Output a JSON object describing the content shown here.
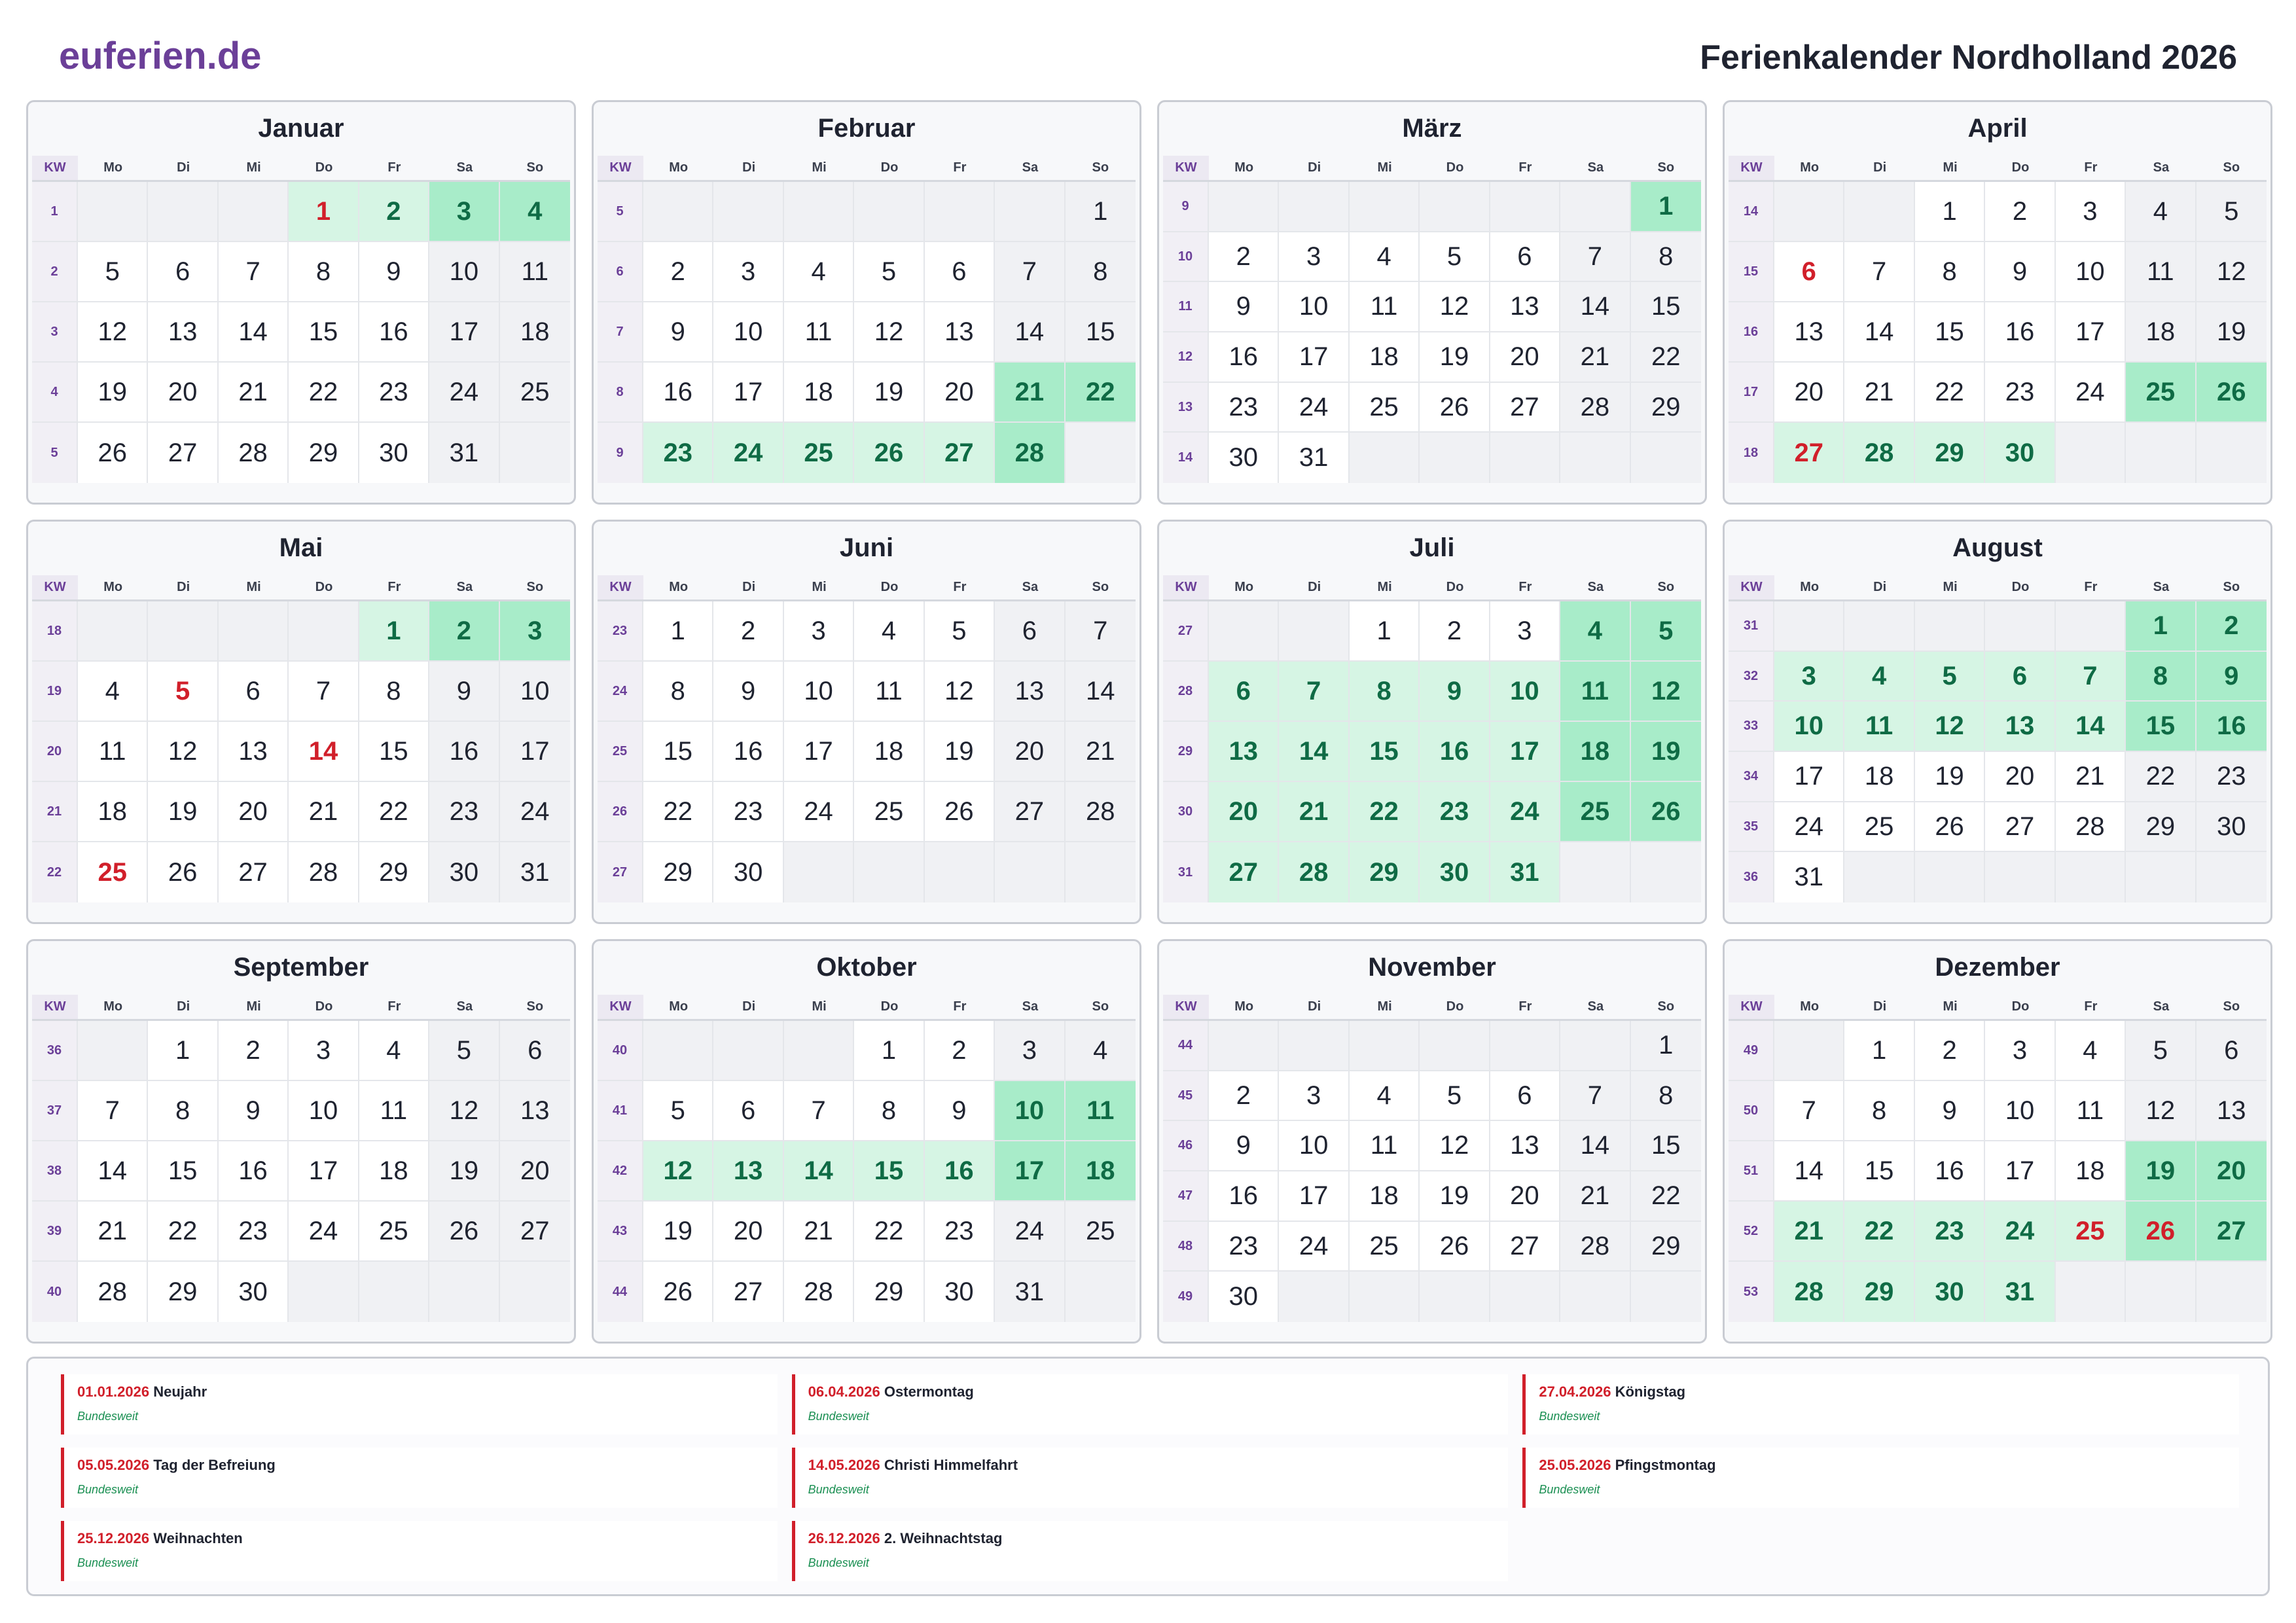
{
  "header": {
    "logo": "euferien.de",
    "title": "Ferienkalender Nordholland 2026"
  },
  "weekday_header": {
    "kw": "KW",
    "days": [
      "Mo",
      "Di",
      "Mi",
      "Do",
      "Fr",
      "Sa",
      "So"
    ]
  },
  "colors": {
    "brand": "#6b3f98",
    "holiday_red": "#d11f2a",
    "vacation_green": "#0f6b45",
    "vacation_bg": "#d6f5e4",
    "vacation_weekend_bg": "#a8ecc9"
  },
  "months": [
    {
      "name": "Januar",
      "startDow": 3,
      "days": 31,
      "kw": [
        "1",
        "2",
        "3",
        "4",
        "5"
      ],
      "vacation": [
        1,
        2,
        3,
        4
      ],
      "holidays": [
        1
      ]
    },
    {
      "name": "Februar",
      "startDow": 6,
      "days": 28,
      "kw": [
        "5",
        "6",
        "7",
        "8",
        "9"
      ],
      "vacation": [
        21,
        22,
        23,
        24,
        25,
        26,
        27,
        28
      ],
      "holidays": []
    },
    {
      "name": "März",
      "startDow": 6,
      "days": 31,
      "kw": [
        "9",
        "10",
        "11",
        "12",
        "13",
        "14"
      ],
      "vacation": [
        1
      ],
      "holidays": []
    },
    {
      "name": "April",
      "startDow": 2,
      "days": 30,
      "kw": [
        "14",
        "15",
        "16",
        "17",
        "18"
      ],
      "vacation": [
        25,
        26,
        27,
        28,
        29,
        30
      ],
      "holidays": [
        6,
        27
      ]
    },
    {
      "name": "Mai",
      "startDow": 4,
      "days": 31,
      "kw": [
        "18",
        "19",
        "20",
        "21",
        "22"
      ],
      "vacation": [
        1,
        2,
        3
      ],
      "holidays": [
        5,
        14,
        25
      ]
    },
    {
      "name": "Juni",
      "startDow": 0,
      "days": 30,
      "kw": [
        "23",
        "24",
        "25",
        "26",
        "27"
      ],
      "vacation": [],
      "holidays": []
    },
    {
      "name": "Juli",
      "startDow": 2,
      "days": 31,
      "kw": [
        "27",
        "28",
        "29",
        "30",
        "31"
      ],
      "vacation": [
        4,
        5,
        6,
        7,
        8,
        9,
        10,
        11,
        12,
        13,
        14,
        15,
        16,
        17,
        18,
        19,
        20,
        21,
        22,
        23,
        24,
        25,
        26,
        27,
        28,
        29,
        30,
        31
      ],
      "holidays": []
    },
    {
      "name": "August",
      "startDow": 5,
      "days": 31,
      "kw": [
        "31",
        "32",
        "33",
        "34",
        "35",
        "36"
      ],
      "vacation": [
        1,
        2,
        3,
        4,
        5,
        6,
        7,
        8,
        9,
        10,
        11,
        12,
        13,
        14,
        15,
        16
      ],
      "holidays": []
    },
    {
      "name": "September",
      "startDow": 1,
      "days": 30,
      "kw": [
        "36",
        "37",
        "38",
        "39",
        "40"
      ],
      "vacation": [],
      "holidays": []
    },
    {
      "name": "Oktober",
      "startDow": 3,
      "days": 31,
      "kw": [
        "40",
        "41",
        "42",
        "43",
        "44"
      ],
      "vacation": [
        10,
        11,
        12,
        13,
        14,
        15,
        16,
        17,
        18
      ],
      "holidays": []
    },
    {
      "name": "November",
      "startDow": 6,
      "days": 30,
      "kw": [
        "44",
        "45",
        "46",
        "47",
        "48",
        "49"
      ],
      "vacation": [],
      "holidays": []
    },
    {
      "name": "Dezember",
      "startDow": 1,
      "days": 31,
      "kw": [
        "49",
        "50",
        "51",
        "52",
        "53"
      ],
      "vacation": [
        19,
        20,
        21,
        22,
        23,
        24,
        25,
        26,
        27,
        28,
        29,
        30,
        31
      ],
      "holidays": [
        25,
        26
      ]
    }
  ],
  "holidays": [
    {
      "date": "01.01.2026",
      "name": "Neujahr",
      "scope": "Bundesweit"
    },
    {
      "date": "06.04.2026",
      "name": "Ostermontag",
      "scope": "Bundesweit"
    },
    {
      "date": "27.04.2026",
      "name": "Königstag",
      "scope": "Bundesweit"
    },
    {
      "date": "05.05.2026",
      "name": "Tag der Befreiung",
      "scope": "Bundesweit"
    },
    {
      "date": "14.05.2026",
      "name": "Christi Himmelfahrt",
      "scope": "Bundesweit"
    },
    {
      "date": "25.05.2026",
      "name": "Pfingstmontag",
      "scope": "Bundesweit"
    },
    {
      "date": "25.12.2026",
      "name": "Weihnachten",
      "scope": "Bundesweit"
    },
    {
      "date": "26.12.2026",
      "name": "2. Weihnachtstag",
      "scope": "Bundesweit"
    }
  ]
}
